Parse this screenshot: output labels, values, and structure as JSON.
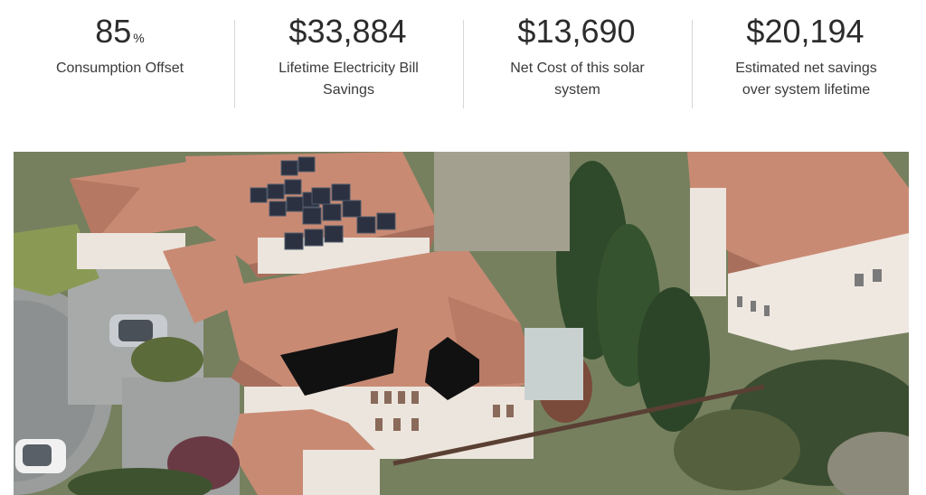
{
  "stats": [
    {
      "value": "85",
      "unit": "%",
      "label": "Consumption Offset"
    },
    {
      "value": "$33,884",
      "unit": "",
      "label": "Lifetime Electricity Bill Savings"
    },
    {
      "value": "$13,690",
      "unit": "",
      "label": "Net Cost of this solar system"
    },
    {
      "value": "$20,194",
      "unit": "",
      "label": "Estimated net savings over system lifetime"
    }
  ],
  "aerial_image": {
    "icon": "satellite-roof-view",
    "colors": {
      "roof_tile": "#c98a74",
      "roof_shadow": "#a86f5c",
      "wall": "#ece5dd",
      "panel_existing": "#2b3140",
      "panel_proposed": "#111111",
      "trees": "#2f4a2a",
      "lawn": "#7d8a5c",
      "pavement": "#9a9d9c"
    }
  }
}
